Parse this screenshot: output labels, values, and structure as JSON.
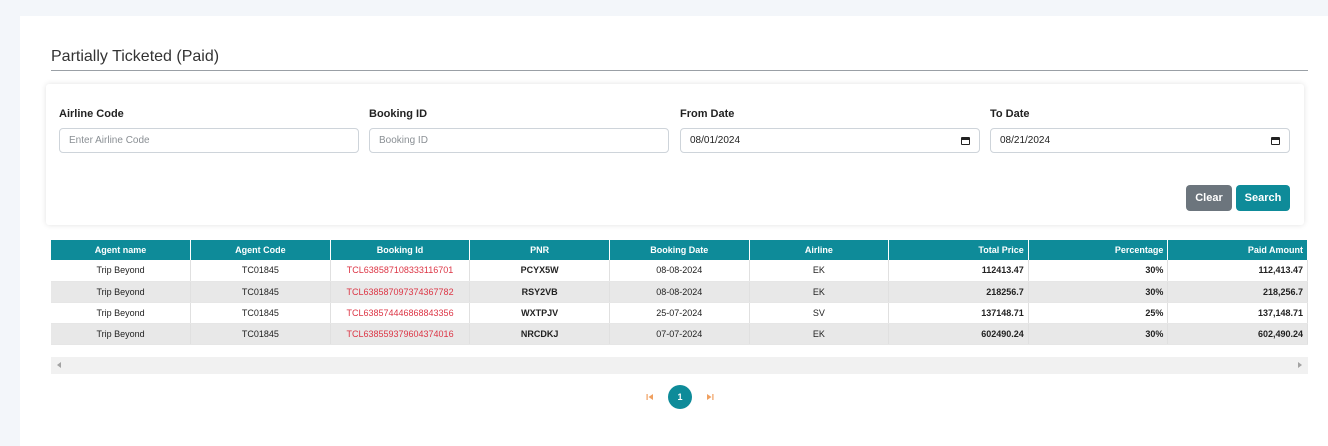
{
  "section": {
    "title": "Partially Ticketed (Paid)"
  },
  "filters": {
    "airline_code": {
      "label": "Airline Code",
      "placeholder": "Enter Airline Code",
      "value": ""
    },
    "booking_id": {
      "label": "Booking ID",
      "placeholder": "Booking ID",
      "value": ""
    },
    "from_date": {
      "label": "From Date",
      "value": "08/01/2024"
    },
    "to_date": {
      "label": "To Date",
      "value": "08/21/2024"
    },
    "clear_label": "Clear",
    "search_label": "Search"
  },
  "table": {
    "headers": [
      "Agent name",
      "Agent Code",
      "Booking Id",
      "PNR",
      "Booking Date",
      "Airline",
      "Total Price",
      "Percentage",
      "Paid Amount"
    ],
    "rows": [
      [
        "Trip Beyond",
        "TC01845",
        "TCL638587108333116701",
        "PCYX5W",
        "08-08-2024",
        "EK",
        "112413.47",
        "30%",
        "112,413.47"
      ],
      [
        "Trip Beyond",
        "TC01845",
        "TCL638587097374367782",
        "RSY2VB",
        "08-08-2024",
        "EK",
        "218256.7",
        "30%",
        "218,256.7"
      ],
      [
        "Trip Beyond",
        "TC01845",
        "TCL638574446868843356",
        "WXTPJV",
        "25-07-2024",
        "SV",
        "137148.71",
        "25%",
        "137,148.71"
      ],
      [
        "Trip Beyond",
        "TC01845",
        "TCL638559379604374016",
        "NRCDKJ",
        "07-07-2024",
        "EK",
        "602490.24",
        "30%",
        "602,490.24"
      ]
    ]
  },
  "pagination": {
    "current_page": "1",
    "first_icon": "first-page-icon",
    "last_icon": "last-page-icon"
  },
  "colors": {
    "accent": "#0e8b99",
    "clear": "#6c757d",
    "link": "#dc3545"
  }
}
